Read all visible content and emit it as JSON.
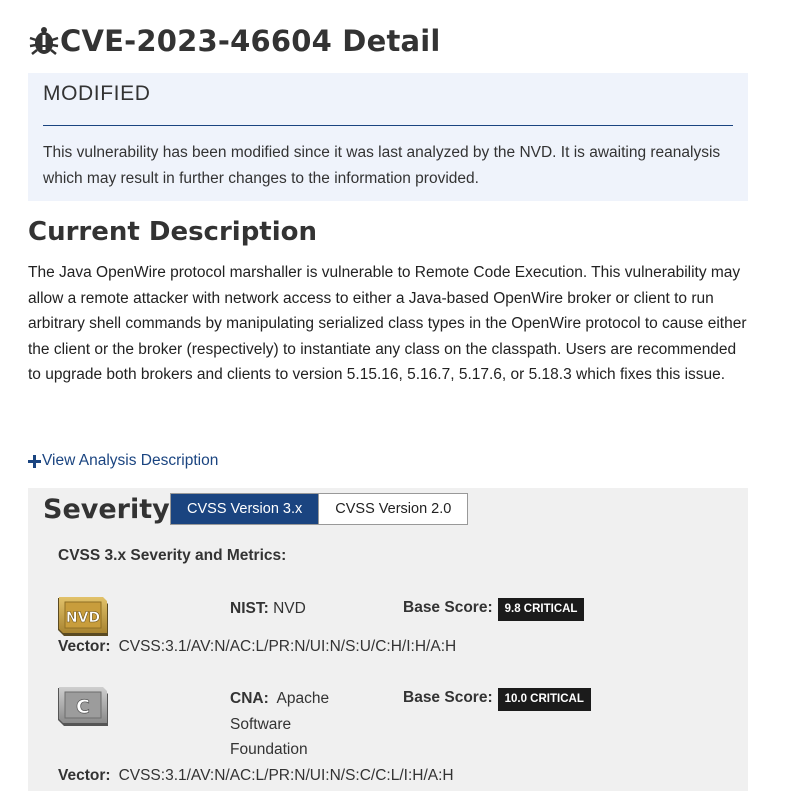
{
  "page": {
    "title": "CVE-2023-46604 Detail",
    "title_icon": "bug-icon"
  },
  "modified": {
    "heading": "MODIFIED",
    "text": "This vulnerability has been modified since it was last analyzed by the NVD. It is awaiting reanalysis which may result in further changes to the information provided."
  },
  "description": {
    "heading": "Current Description",
    "text": "The Java OpenWire protocol marshaller is vulnerable to Remote Code Execution. This vulnerability may allow a remote attacker with network access to either a Java-based OpenWire broker or client to run arbitrary shell commands by manipulating serialized class types in the OpenWire protocol to cause either the client or the broker (respectively) to instantiate any class on the classpath. Users are recommended to upgrade both brokers and clients to version 5.15.16, 5.16.7, 5.17.6, or 5.18.3 which fixes this issue.",
    "analysis_link": "View Analysis Description"
  },
  "severity": {
    "heading": "Severity",
    "tabs": [
      {
        "label": "CVSS Version 3.x",
        "active": true
      },
      {
        "label": "CVSS Version 2.0",
        "active": false
      }
    ],
    "metrics_heading": "CVSS 3.x Severity and Metrics:",
    "nist": {
      "badge_icon": "nvd-badge-icon",
      "source_label": "NIST:",
      "source_value": "NVD",
      "base_label": "Base Score:",
      "score": "9.8 CRITICAL",
      "vector_label": "Vector:",
      "vector": "CVSS:3.1/AV:N/AC:L/PR:N/UI:N/S:U/C:H/I:H/A:H"
    },
    "cna": {
      "badge_icon": "cna-badge-icon",
      "source_label": "CNA:",
      "source_value": "Apache Software Foundation",
      "base_label": "Base Score:",
      "score": "10.0 CRITICAL",
      "vector_label": "Vector:",
      "vector": "CVSS:3.1/AV:N/AC:L/PR:N/UI:N/S:C/C:L/I:H/A:H"
    }
  },
  "colors": {
    "link": "#1a4480",
    "modified_bg": "#eff3fb",
    "severity_bg": "#f0f0f0",
    "critical_badge": "#1b1b1b",
    "badge_gold": "#c8a44c"
  }
}
